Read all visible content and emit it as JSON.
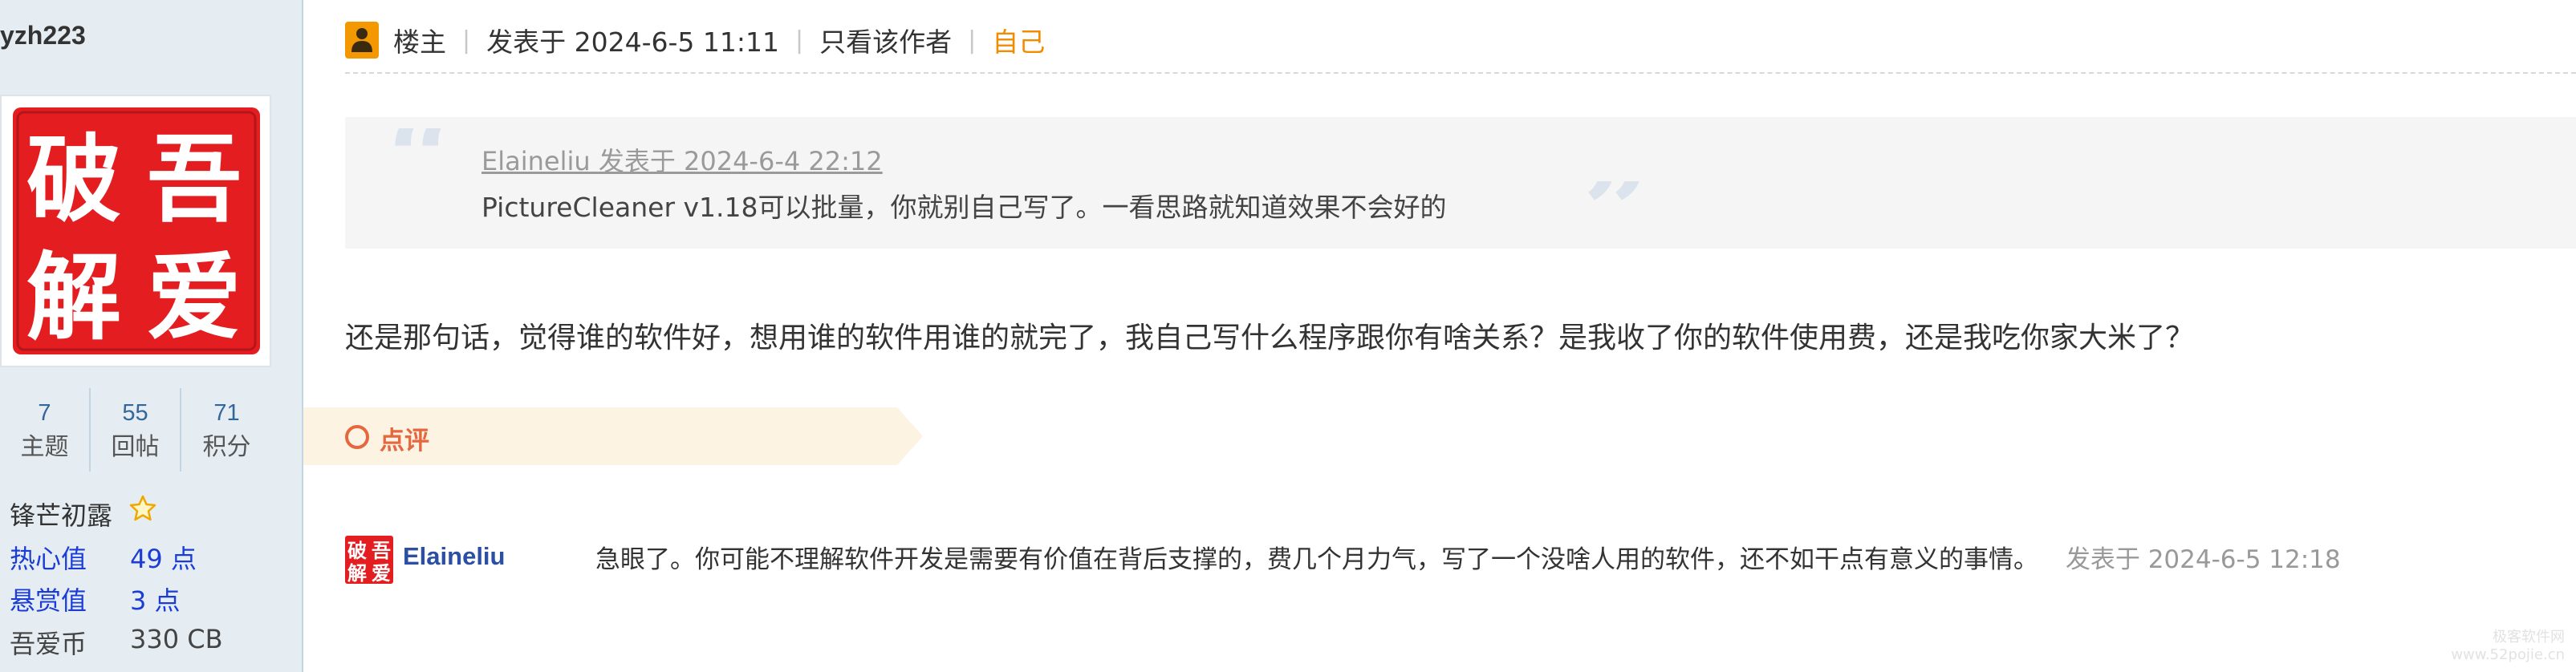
{
  "sidebar": {
    "username": "yzh223",
    "avatar_text": [
      "破",
      "吾",
      "解",
      "爱"
    ],
    "stats": [
      {
        "value": "7",
        "label": "主题"
      },
      {
        "value": "55",
        "label": "回帖"
      },
      {
        "value": "71",
        "label": "积分"
      }
    ],
    "rank": "锋芒初露",
    "details": [
      {
        "key": "热心值",
        "value": "49 点"
      },
      {
        "key": "悬赏值",
        "value": "3 点"
      },
      {
        "key": "吾爱币",
        "value": "330 CB"
      }
    ]
  },
  "header": {
    "floor_label": "楼主",
    "posted_at": "发表于 2024-6-5 11:11",
    "only_author": "只看该作者",
    "self_label": "自己"
  },
  "quote": {
    "author_line": "Elaineliu 发表于 2024-6-4 22:12",
    "text": "PictureCleaner v1.18可以批量，你就别自己写了。一看思路就知道效果不会好的"
  },
  "main_text": "还是那句话，觉得谁的软件好，想用谁的软件用谁的就完了，我自己写什么程序跟你有啥关系？是我收了你的软件使用费，还是我吃你家大米了？",
  "comments_tab": {
    "label": "点评"
  },
  "comment": {
    "user": "Elaineliu",
    "text": "急眼了。你可能不理解软件开发是需要有价值在背后支撑的，费几个月力气，写了一个没啥人用的软件，还不如干点有意义的事情。",
    "time": "发表于 2024-6-5 12:18"
  },
  "watermark": [
    "极客软件网",
    "www.52pojie.cn"
  ],
  "colors": {
    "sidebar_bg": "#e5edf2",
    "stat_blue": "#336699",
    "link_blue": "#1b3dd6",
    "accent_orange": "#f08c00",
    "comment_red": "#e5673f",
    "seal_red": "#e41e20"
  }
}
